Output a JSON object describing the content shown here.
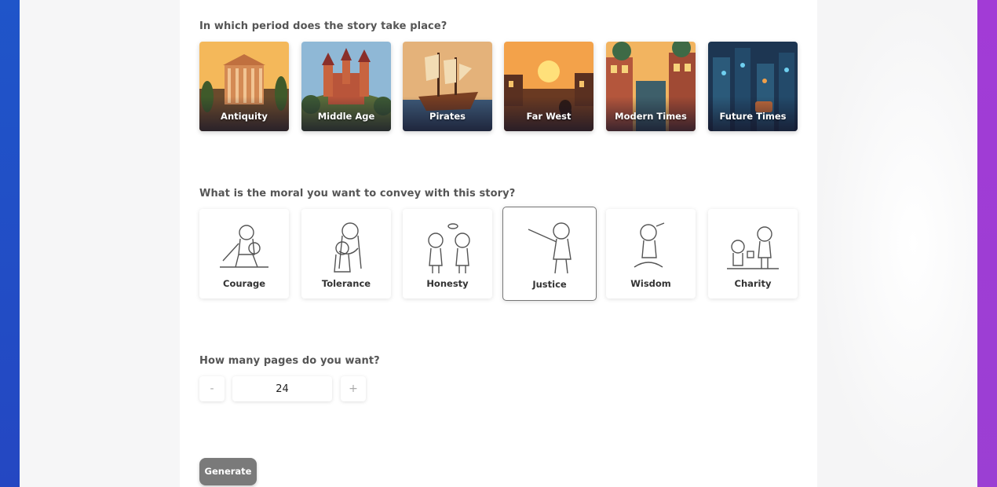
{
  "period": {
    "question": "In which period does the story take place?",
    "options": [
      {
        "label": "Antiquity",
        "colors": [
          "#f4b85a",
          "#b0623a",
          "#5a3a2a"
        ]
      },
      {
        "label": "Middle Age",
        "colors": [
          "#9fc6e0",
          "#c56a45",
          "#4d5a3a"
        ]
      },
      {
        "label": "Pirates",
        "colors": [
          "#e6a963",
          "#8b4a2b",
          "#3d4c63"
        ]
      },
      {
        "label": "Far West",
        "colors": [
          "#f2a64a",
          "#b8622c",
          "#4a2a20"
        ]
      },
      {
        "label": "Modern Times",
        "colors": [
          "#f0b35e",
          "#b3563a",
          "#2f4a56"
        ]
      },
      {
        "label": "Future Times",
        "colors": [
          "#3a7fa0",
          "#1f3a63",
          "#142238"
        ]
      }
    ]
  },
  "moral": {
    "question": "What is the moral you want to convey with this story?",
    "options": [
      {
        "label": "Courage",
        "icon": "knight-child-sketch-icon",
        "selected": false
      },
      {
        "label": "Tolerance",
        "icon": "hugging-children-sketch-icon",
        "selected": false
      },
      {
        "label": "Honesty",
        "icon": "two-children-sketch-icon",
        "selected": false
      },
      {
        "label": "Justice",
        "icon": "pointing-child-sketch-icon",
        "selected": true
      },
      {
        "label": "Wisdom",
        "icon": "sitting-child-sketch-icon",
        "selected": false
      },
      {
        "label": "Charity",
        "icon": "sharing-children-sketch-icon",
        "selected": false
      }
    ]
  },
  "pages": {
    "question": "How many pages do you want?",
    "decrement_label": "-",
    "increment_label": "+",
    "value": "24"
  },
  "generate_label": "Generate"
}
